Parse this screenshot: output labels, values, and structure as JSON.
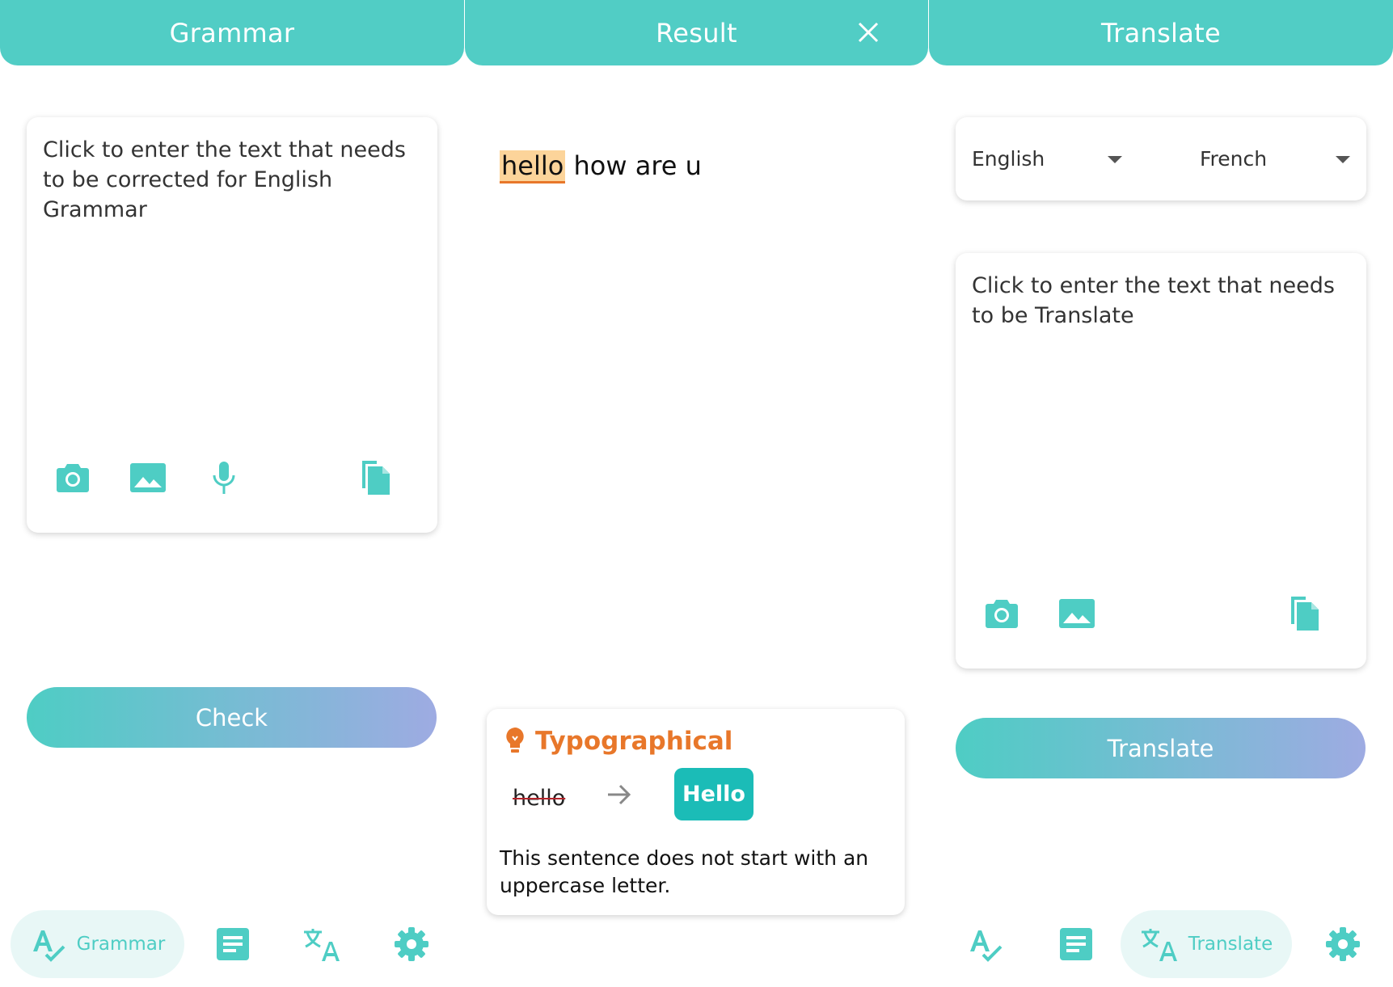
{
  "grammar_panel": {
    "title": "Grammar",
    "input_placeholder": "Click to enter the text that needs to be corrected for English Grammar",
    "check_label": "Check"
  },
  "result_panel": {
    "title": "Result",
    "sentence_highlight": "hello",
    "sentence_rest": " how are u",
    "suggestion": {
      "category": "Typographical",
      "original": "hello",
      "replacement": "Hello",
      "description": "This sentence does not start with an uppercase letter."
    }
  },
  "translate_panel": {
    "title": "Translate",
    "source_language": "English",
    "target_language": "French",
    "input_placeholder": "Click to enter the text that needs to be Translate",
    "translate_label": "Translate"
  },
  "bottom_nav": {
    "grammar_label": "Grammar",
    "translate_label": "Translate"
  },
  "colors": {
    "accent": "#51cdc5",
    "accent_dark": "#1bbcb7",
    "warning": "#e8772a",
    "highlight": "#fcd49a"
  }
}
